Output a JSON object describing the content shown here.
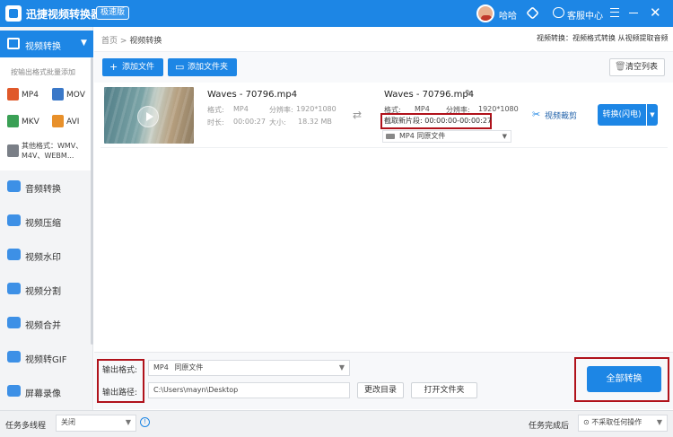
{
  "titlebar": {
    "app_title": "迅捷视频转换器",
    "speed_badge": "极速版",
    "username": "哈哈",
    "service_label": "客服中心"
  },
  "sidebar": {
    "active_label": "视频转换",
    "format_hint": "按输出格式批量添加",
    "formats": [
      "MP4",
      "MOV",
      "MKV",
      "AVI"
    ],
    "other_formats": "其他格式：WMV、M4V、WEBM...",
    "items": [
      {
        "label": "音频转换",
        "icon": "audio-icon"
      },
      {
        "label": "视频压缩",
        "icon": "compress-icon"
      },
      {
        "label": "视频水印",
        "icon": "watermark-icon"
      },
      {
        "label": "视频分割",
        "icon": "split-icon"
      },
      {
        "label": "视频合并",
        "icon": "merge-icon"
      },
      {
        "label": "视频转GIF",
        "icon": "gif-icon"
      },
      {
        "label": "屏幕录像",
        "icon": "record-icon"
      }
    ]
  },
  "breadcrumb": {
    "home": "首页",
    "separator": ">",
    "current": "视频转换",
    "right_hint": "视频转换：视频格式转换 从视频提取音频"
  },
  "toolbar": {
    "add_file": "添加文件",
    "add_folder": "添加文件夹",
    "clear_list": "清空列表"
  },
  "file": {
    "name": "Waves - 70796.mp4",
    "format_label": "格式:",
    "format": "MP4",
    "resolution_label": "分辨率:",
    "resolution": "1920*1080",
    "duration_label": "时长:",
    "duration": "00:00:27",
    "size_label": "大小:",
    "size": "18.32 MB",
    "output_name": "Waves - 70796.mp4",
    "out_format": "MP4",
    "out_resolution": "1920*1080",
    "clip_label": "截取新片段:",
    "clip_range": "00:00:00-00:00:27",
    "output_format_select": "MP4",
    "output_format_select_sub": "同原文件",
    "cut_label": "视频裁剪",
    "convert_label": "转换(闪电)"
  },
  "bottom": {
    "output_format_label": "输出格式:",
    "output_format_value": "MP4",
    "output_format_sub": "同原文件",
    "output_path_label": "输出路径:",
    "output_path_value": "C:\\Users\\mayn\\Desktop",
    "change_dir": "更改目录",
    "open_folder": "打开文件夹",
    "convert_all": "全部转换"
  },
  "statusbar": {
    "multithread_label": "任务多线程",
    "multithread_value": "关闭",
    "after_complete_label": "任务完成后",
    "after_complete_value": "不采取任何操作"
  },
  "colors": {
    "brand": "#1d86e5",
    "highlight_box": "#b0121b"
  }
}
